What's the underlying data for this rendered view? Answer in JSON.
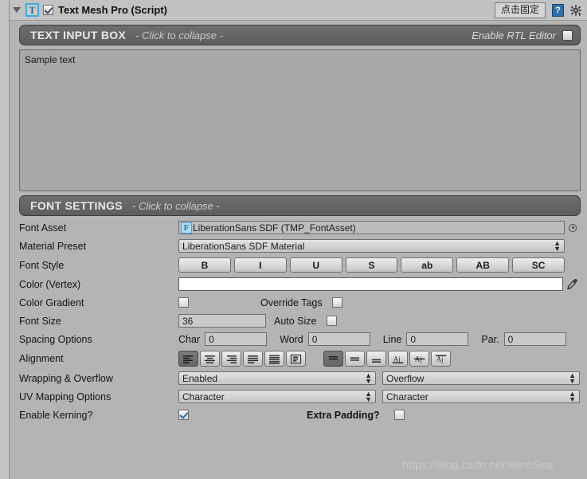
{
  "component": {
    "title": "Text Mesh Pro (Script)",
    "icon_letter": "T",
    "enabled": true,
    "tooltip": "点击固定",
    "help_glyph": "?"
  },
  "text_input_section": {
    "title": "TEXT INPUT BOX",
    "hint": "- Click to collapse -",
    "rtl_label": "Enable RTL Editor",
    "rtl_checked": false,
    "text_value": "Sample text"
  },
  "font_settings_section": {
    "title": "FONT SETTINGS",
    "hint": "- Click to collapse -"
  },
  "fields": {
    "font_asset": {
      "label": "Font Asset",
      "value": "LiberationSans SDF (TMP_FontAsset)",
      "icon_letter": "F"
    },
    "material_preset": {
      "label": "Material Preset",
      "value": "LiberationSans SDF Material"
    },
    "font_style": {
      "label": "Font Style",
      "buttons": [
        "B",
        "I",
        "U",
        "S",
        "ab",
        "AB",
        "SC"
      ]
    },
    "color_vertex": {
      "label": "Color (Vertex)",
      "color": "#ffffff"
    },
    "color_gradient": {
      "label": "Color Gradient",
      "checked": false,
      "override_label": "Override Tags",
      "override_checked": false
    },
    "font_size": {
      "label": "Font Size",
      "value": "36",
      "auto_label": "Auto Size",
      "auto_checked": false
    },
    "spacing": {
      "label": "Spacing Options",
      "items": [
        {
          "label": "Char",
          "value": "0"
        },
        {
          "label": "Word",
          "value": "0"
        },
        {
          "label": "Line",
          "value": "0"
        },
        {
          "label": "Par.",
          "value": "0"
        }
      ]
    },
    "alignment": {
      "label": "Alignment",
      "horizontal": [
        "align-left",
        "align-center",
        "align-right",
        "align-justified",
        "align-flush",
        "align-geometry"
      ],
      "horizontal_selected": 0,
      "vertical": [
        "align-top",
        "align-middle",
        "align-bottom",
        "align-baseline",
        "align-midline",
        "align-capline"
      ],
      "vertical_selected": 0
    },
    "wrapping_overflow": {
      "label": "Wrapping & Overflow",
      "wrapping_value": "Enabled",
      "overflow_value": "Overflow"
    },
    "uv_mapping": {
      "label": "UV Mapping Options",
      "horizontal_value": "Character",
      "vertical_value": "Character"
    },
    "kerning": {
      "label": "Enable Kerning?",
      "checked": true,
      "padding_label": "Extra Padding?",
      "padding_checked": false
    }
  },
  "watermark": "https://blog.csdn.net/elineSea"
}
